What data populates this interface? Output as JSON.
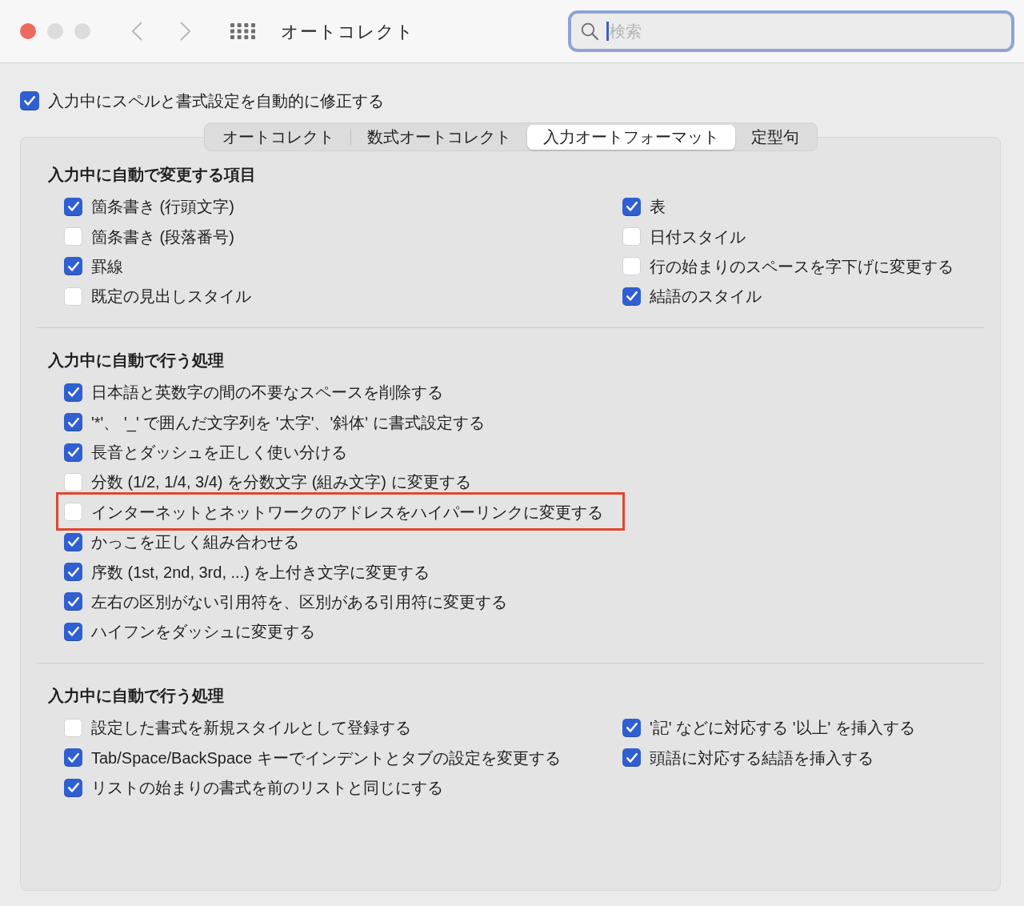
{
  "window": {
    "title": "オートコレクト",
    "controls": [
      {
        "kind": "close",
        "disabled": false
      },
      {
        "kind": "minimize",
        "disabled": true
      },
      {
        "kind": "zoom",
        "disabled": true
      }
    ]
  },
  "toolbar": {
    "navigation": [
      {
        "kind": "back",
        "disabled": true
      },
      {
        "kind": "forward",
        "disabled": true
      }
    ]
  },
  "search": {
    "placeholder": "検索",
    "focused": true
  },
  "master_option": {
    "label": "入力中にスペルと書式設定を自動的に修正する",
    "checked": true
  },
  "tabs": [
    {
      "label": "オートコレクト",
      "selected": false
    },
    {
      "label": "数式オートコレクト",
      "selected": false
    },
    {
      "label": "入力オートフォーマット",
      "selected": true
    },
    {
      "label": "定型句",
      "selected": false
    }
  ],
  "sections": [
    {
      "heading": "入力中に自動で変更する項目",
      "columns": [
        {
          "items": [
            {
              "label": "箇条書き (行頭文字)",
              "checked": true
            },
            {
              "label": "箇条書き (段落番号)",
              "checked": false
            },
            {
              "label": "罫線",
              "checked": true
            },
            {
              "label": "既定の見出しスタイル",
              "checked": false
            }
          ]
        },
        {
          "items": [
            {
              "label": "表",
              "checked": true
            },
            {
              "label": "日付スタイル",
              "checked": false
            },
            {
              "label": "行の始まりのスペースを字下げに変更する",
              "checked": false
            },
            {
              "label": "結語のスタイル",
              "checked": true
            }
          ]
        }
      ]
    },
    {
      "heading": "入力中に自動で行う処理",
      "columns": [
        {
          "items": [
            {
              "label": "日本語と英数字の間の不要なスペースを削除する",
              "checked": true,
              "highlighted": false
            },
            {
              "label": "'*'、 '_' で囲んだ文字列を '太字'、'斜体' に書式設定する",
              "checked": true,
              "highlighted": false
            },
            {
              "label": "長音とダッシュを正しく使い分ける",
              "checked": true,
              "highlighted": false
            },
            {
              "label": "分数 (1/2, 1/4, 3/4) を分数文字 (組み文字) に変更する",
              "checked": false,
              "highlighted": false
            },
            {
              "label": "インターネットとネットワークのアドレスをハイパーリンクに変更する",
              "checked": false,
              "highlighted": true
            },
            {
              "label": "かっこを正しく組み合わせる",
              "checked": true,
              "highlighted": false
            },
            {
              "label": "序数 (1st, 2nd, 3rd, ...) を上付き文字に変更する",
              "checked": true,
              "highlighted": false
            },
            {
              "label": "左右の区別がない引用符を、区別がある引用符に変更する",
              "checked": true,
              "highlighted": false
            },
            {
              "label": "ハイフンをダッシュに変更する",
              "checked": true,
              "highlighted": false
            }
          ]
        }
      ]
    },
    {
      "heading": "入力中に自動で行う処理",
      "columns": [
        {
          "items": [
            {
              "label": "設定した書式を新規スタイルとして登録する",
              "checked": false
            },
            {
              "label": "Tab/Space/BackSpace キーでインデントとタブの設定を変更する",
              "checked": true
            },
            {
              "label": "リストの始まりの書式を前のリストと同じにする",
              "checked": true
            }
          ]
        },
        {
          "items": [
            {
              "label": "'記' などに対応する '以上' を挿入する",
              "checked": true
            },
            {
              "label": "頭語に対応する結語を挿入する",
              "checked": true
            }
          ]
        }
      ]
    }
  ]
}
